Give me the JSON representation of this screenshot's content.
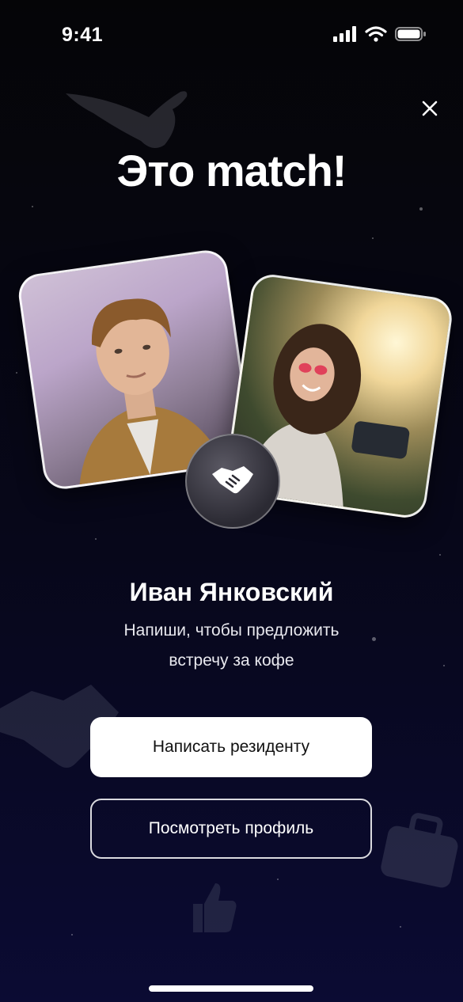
{
  "status_bar": {
    "time": "9:41"
  },
  "title": "Это match!",
  "match": {
    "name": "Иван Янковский",
    "subtitle_line1": "Напиши, чтобы предложить",
    "subtitle_line2": "встречу за кофе"
  },
  "buttons": {
    "primary_label": "Написать резиденту",
    "secondary_label": "Посмотреть профиль"
  },
  "icons": {
    "close": "close-icon",
    "handshake": "handshake-icon",
    "signal": "signal-icon",
    "wifi": "wifi-icon",
    "battery": "battery-icon"
  },
  "colors": {
    "background_top": "#050507",
    "background_bottom": "#0b0b33",
    "primary_button": "#ffffff",
    "text": "#ffffff"
  }
}
